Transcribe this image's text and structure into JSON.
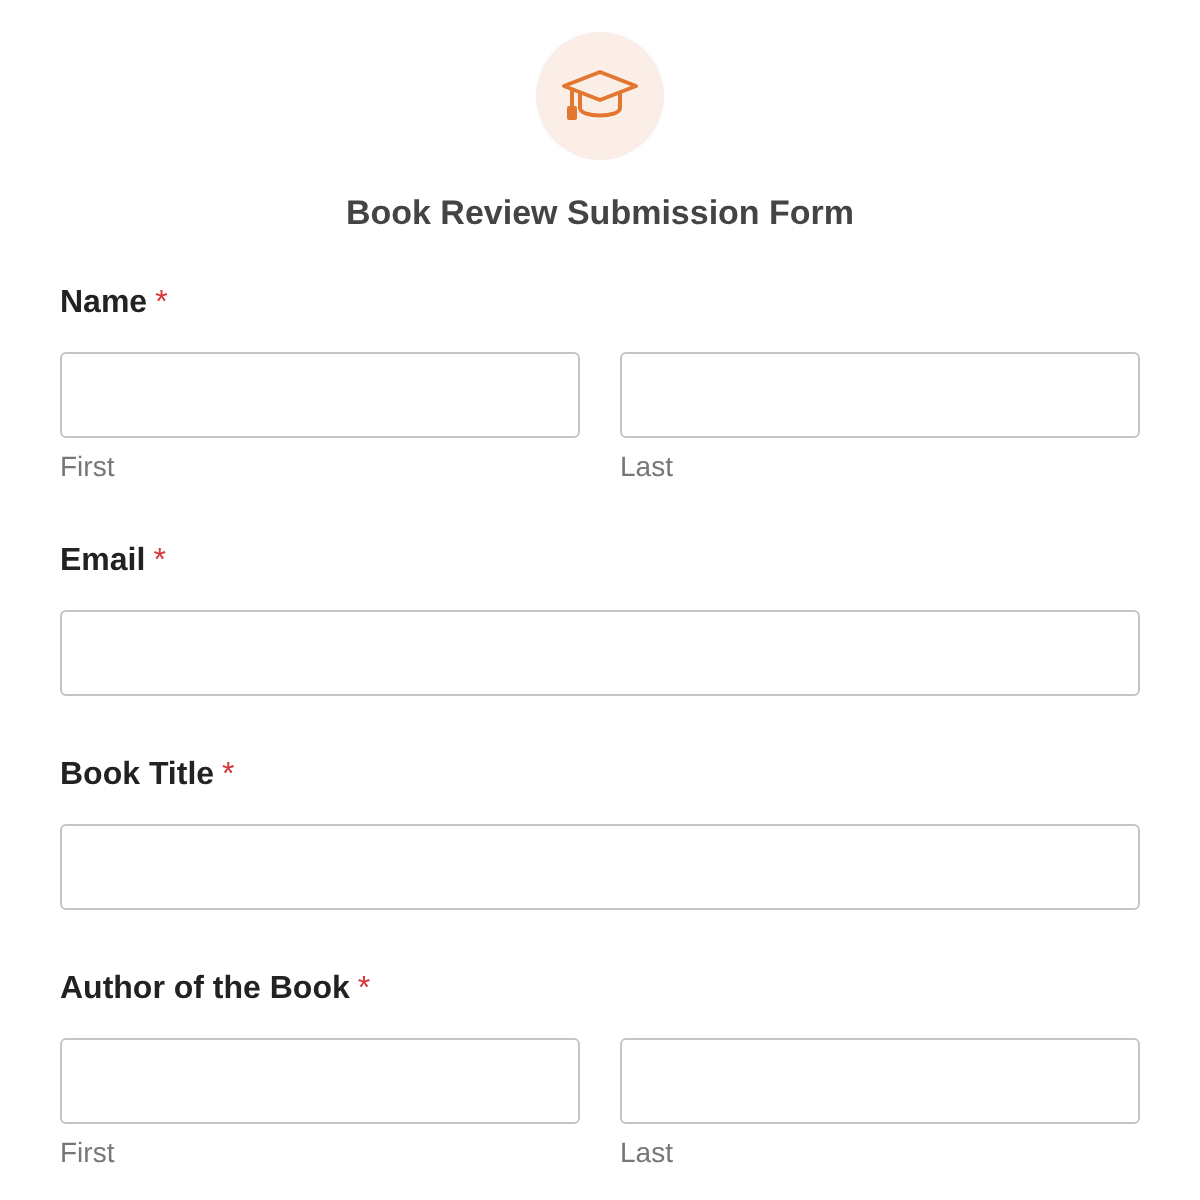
{
  "form": {
    "title": "Book Review Submission Form"
  },
  "fields": [
    {
      "kind": "pair",
      "label": "Name",
      "required_mark": "*",
      "sublabels": [
        "First",
        "Last"
      ]
    },
    {
      "kind": "single",
      "label": "Email",
      "required_mark": "*"
    },
    {
      "kind": "single",
      "label": "Book Title",
      "required_mark": "*"
    },
    {
      "kind": "pair",
      "label": "Author of the Book",
      "required_mark": "*",
      "sublabels": [
        "First",
        "Last"
      ]
    }
  ]
}
